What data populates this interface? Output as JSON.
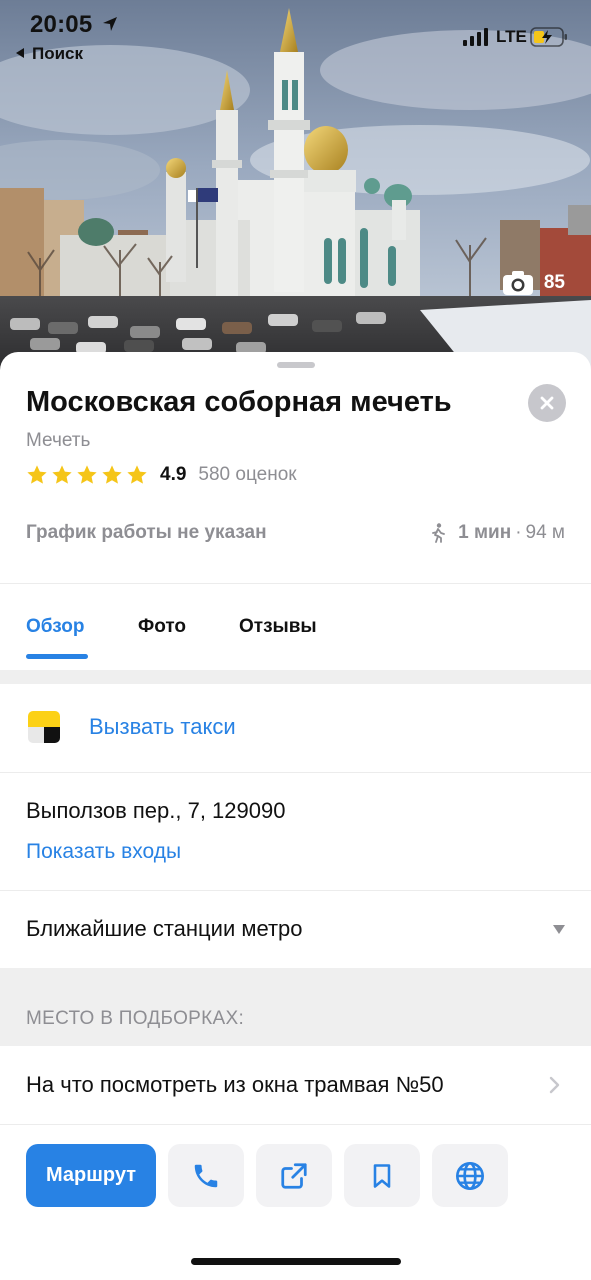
{
  "status_bar": {
    "time": "20:05",
    "back_label": "Поиск",
    "network": "LTE"
  },
  "hero": {
    "photo_count": "85"
  },
  "place": {
    "title": "Московская соборная мечеть",
    "category": "Мечеть",
    "rating_value": "4.9",
    "rating_count": "580 оценок",
    "stars_filled": 5,
    "hours": "График работы не указан",
    "walk_time": "1 мин",
    "walk_separator": "·",
    "walk_distance": "94 м"
  },
  "tabs": [
    {
      "label": "Обзор",
      "active": true
    },
    {
      "label": "Фото",
      "active": false
    },
    {
      "label": "Отзывы",
      "active": false
    }
  ],
  "taxi": {
    "label": "Вызвать такси"
  },
  "address": {
    "text": "Выползов пер., 7, 129090",
    "entrances_link": "Показать входы"
  },
  "metro": {
    "label": "Ближайшие станции метро"
  },
  "collections": {
    "header": "МЕСТО В ПОДБОРКАХ:",
    "items": [
      {
        "label": "На что посмотреть из окна трамвая №50"
      }
    ]
  },
  "actions": {
    "route_label": "Маршрут",
    "icons": [
      "phone-icon",
      "share-icon",
      "bookmark-icon",
      "globe-icon"
    ]
  },
  "colors": {
    "accent": "#2882e4",
    "star": "#f5c518",
    "secondary_text": "#8e8e93"
  }
}
